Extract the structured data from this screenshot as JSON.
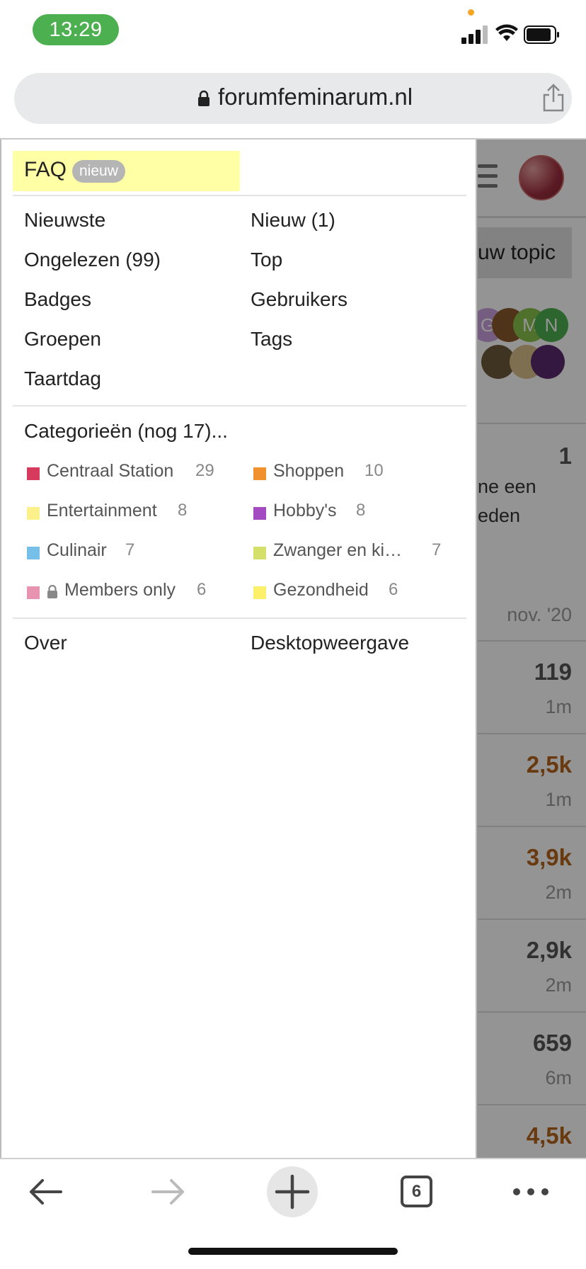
{
  "status_bar": {
    "time": "13:29",
    "icons": [
      "cellular-signal-icon",
      "wifi-icon",
      "battery-icon"
    ],
    "time_pill_color": "#4caf50"
  },
  "url_bar": {
    "domain": "forumfeminarum.nl",
    "icons": [
      "lock-icon",
      "share-icon"
    ]
  },
  "background_page": {
    "new_topic_button": "uw topic",
    "participants": [
      "G",
      "M",
      "N"
    ],
    "first_topic": {
      "count": "1",
      "excerpt_lines": [
        "ne een",
        "eden"
      ],
      "activity": "nov. '20"
    },
    "topics": [
      {
        "count": "119",
        "time": "1m",
        "hot": false
      },
      {
        "count": "2,5k",
        "time": "1m",
        "hot": true
      },
      {
        "count": "3,9k",
        "time": "2m",
        "hot": true
      },
      {
        "count": "2,9k",
        "time": "2m",
        "hot": false
      },
      {
        "count": "659",
        "time": "6m",
        "hot": false
      },
      {
        "count": "4,5k",
        "time": "",
        "hot": true
      }
    ]
  },
  "menu": {
    "faq": {
      "label": "FAQ",
      "badge": "nieuw",
      "highlight_color": "#ffffa6"
    },
    "links": [
      "Nieuwste",
      "Nieuw (1)",
      "Ongelezen (99)",
      "Top",
      "Badges",
      "Gebruikers",
      "Groepen",
      "Tags",
      "Taartdag"
    ],
    "categories_title": "Categorieën (nog 17)...",
    "categories": [
      {
        "name": "Centraal Station",
        "count": "29",
        "color": "#d63b5e"
      },
      {
        "name": "Shoppen",
        "count": "10",
        "color": "#f0912e"
      },
      {
        "name": "Entertainment",
        "count": "8",
        "color": "#fcf08a"
      },
      {
        "name": "Hobby's",
        "count": "8",
        "color": "#a54bc2"
      },
      {
        "name": "Culinair",
        "count": "7",
        "color": "#76bfe8"
      },
      {
        "name": "Zwanger en ki…",
        "count": "7",
        "color": "#d5e06a"
      },
      {
        "name": "Members only",
        "count": "6",
        "color": "#e893b0",
        "locked": true
      },
      {
        "name": "Gezondheid",
        "count": "6",
        "color": "#fcf06a"
      }
    ],
    "footer_links": [
      "Over",
      "Desktopweergave"
    ]
  },
  "toolbar": {
    "tab_count": "6",
    "icons": [
      "back-arrow-icon",
      "forward-arrow-icon",
      "plus-icon",
      "tabs-icon",
      "more-icon"
    ]
  }
}
